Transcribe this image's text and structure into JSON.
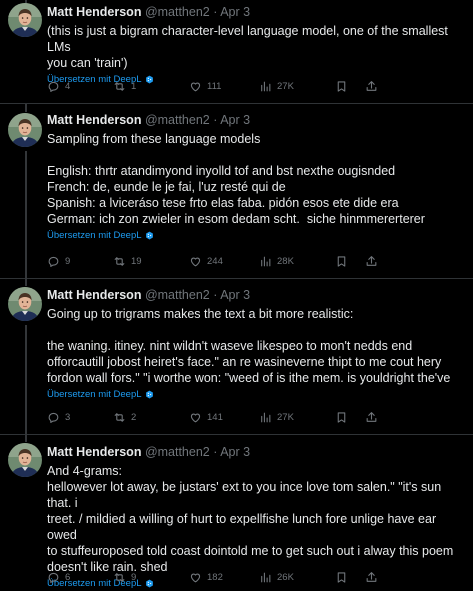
{
  "translate_label": "Übersetzen mit DeepL",
  "tweets": [
    {
      "author": "Matt Henderson",
      "handle": "@matthen2",
      "sep": "·",
      "date": "Apr 3",
      "lines": [
        "(this is just a bigram character-level language model, one of the smallest LMs",
        "you can 'train')"
      ],
      "replies": "4",
      "reposts": "1",
      "likes": "111",
      "views": "27K"
    },
    {
      "author": "Matt Henderson",
      "handle": "@matthen2",
      "sep": "·",
      "date": "Apr 3",
      "lines": [
        "Sampling from these language models",
        "English: thrtr atandimyond inyolld tof and bst nexthe ougisnded",
        "French: de, eunde le je fai, l'uz resté qui de",
        "Spanish: a lviceráso tese frto elas faba. pidón esos ete dide era",
        "German: ich zon zwieler in esom dedam scht.  siche hinmmererterer"
      ],
      "replies": "9",
      "reposts": "19",
      "likes": "244",
      "views": "28K"
    },
    {
      "author": "Matt Henderson",
      "handle": "@matthen2",
      "sep": "·",
      "date": "Apr 3",
      "lines": [
        "Going up to trigrams makes the text a bit more realistic:",
        "the waning. itiney. nint wildn't waseve likespeo to mon't nedds end",
        "offorcautill jobost heiret's face.\" an re wasineverne thipt to me cout hery",
        "fordon wall fors.\" \"i worthe won: \"weed of is ithe mem. is youldright the've"
      ],
      "replies": "3",
      "reposts": "2",
      "likes": "141",
      "views": "27K"
    },
    {
      "author": "Matt Henderson",
      "handle": "@matthen2",
      "sep": "·",
      "date": "Apr 3",
      "lines": [
        "And 4-grams:",
        "hellowever lot away, be justars' ext to you ince love tom salen.\" \"it's sun that. i",
        "treet. / mildied a willing of hurt to expellfishe lunch fore unlige have ear owed",
        "to stuffeuroposed told coast dointold me to get such out i alway this poem",
        "doesn't like rain. shed"
      ],
      "replies": "6",
      "reposts": "9",
      "likes": "182",
      "views": "26K"
    }
  ],
  "icons": {
    "reply": "reply-icon",
    "repost": "repost-icon",
    "like": "heart-icon",
    "views": "views-chart-icon",
    "bookmark": "bookmark-icon",
    "share": "share-icon",
    "deepl": "deepl-logo-icon"
  },
  "colors": {
    "background": "#000000",
    "text": "#e7e9ea",
    "muted": "#71767b",
    "link": "#1d9bf0",
    "divider": "#2f3336"
  }
}
